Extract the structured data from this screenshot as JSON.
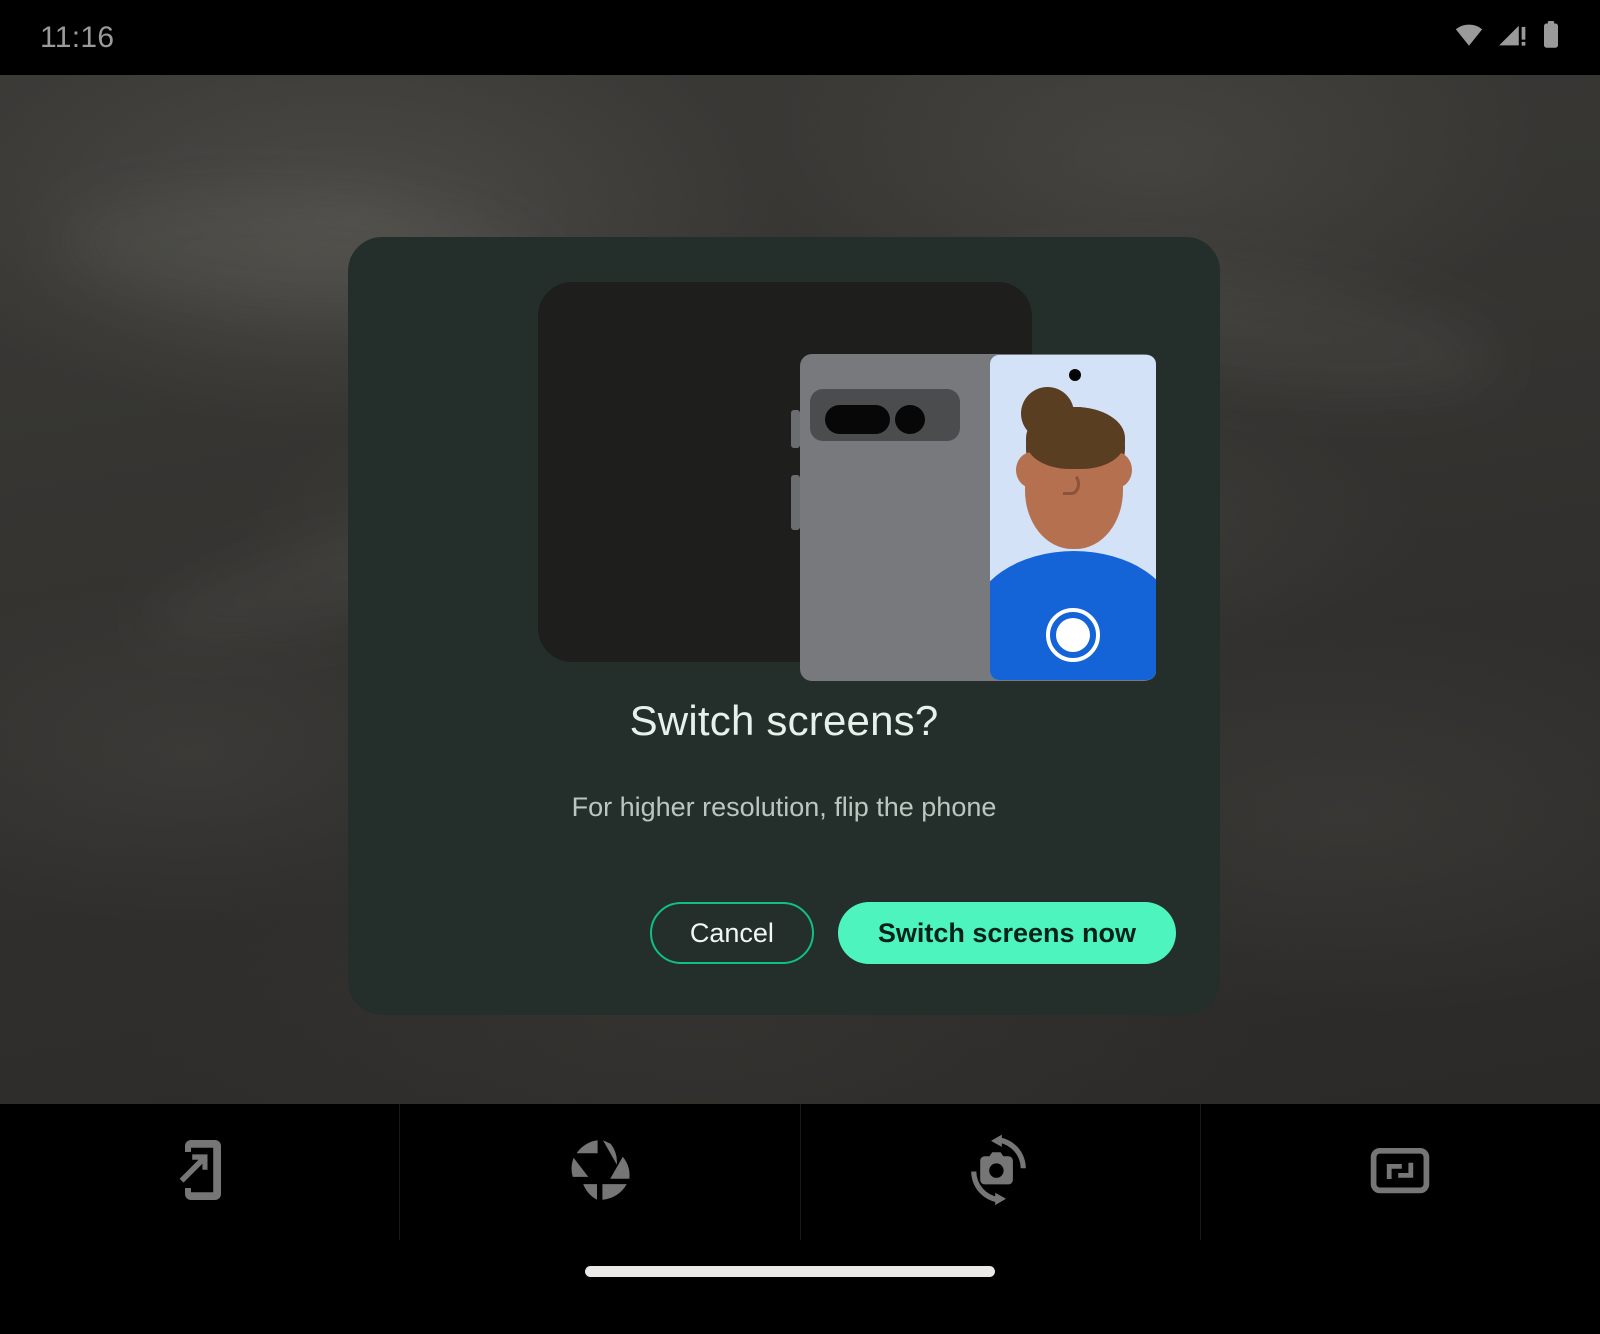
{
  "status_bar": {
    "time": "11:16",
    "icons": [
      {
        "name": "wifi-icon",
        "label": "Wi-Fi"
      },
      {
        "name": "cellular-signal-warning-icon",
        "label": "Mobile signal, no service"
      },
      {
        "name": "battery-icon",
        "label": "Battery"
      }
    ]
  },
  "dialog": {
    "title": "Switch screens?",
    "subtitle": "For higher resolution, flip the phone",
    "cancel_label": "Cancel",
    "confirm_label": "Switch screens now",
    "illustration": {
      "name": "foldable-phone-selfie-illustration",
      "description": "Folded phone showing rear cover camera bar on the left and cover display with a person's selfie and shutter button on the right"
    }
  },
  "toolbar": {
    "items": [
      {
        "name": "switch-screen-icon",
        "label": "Switch screen"
      },
      {
        "name": "camera-shutter-icon",
        "label": "Shutter"
      },
      {
        "name": "flip-camera-icon",
        "label": "Flip camera"
      },
      {
        "name": "aspect-ratio-icon",
        "label": "Aspect ratio"
      }
    ]
  },
  "navigation": {
    "gesture_pill_label": "Home gesture bar"
  },
  "colors": {
    "dialog_surface": "#242f2b",
    "primary_button": "#4df4bd",
    "outline_button_border": "#10bf87",
    "title_text": "#e6f1ec",
    "subtitle_text": "#bac6c0",
    "illustration_frame": "#1e1e1c",
    "phone_body": "#77797c",
    "inner_screen": "#d4e2f8",
    "shirt_blue": "#1464d8",
    "skin": "#b4704f",
    "hair": "#5a3e22",
    "status_bar_bg": "#000000"
  }
}
